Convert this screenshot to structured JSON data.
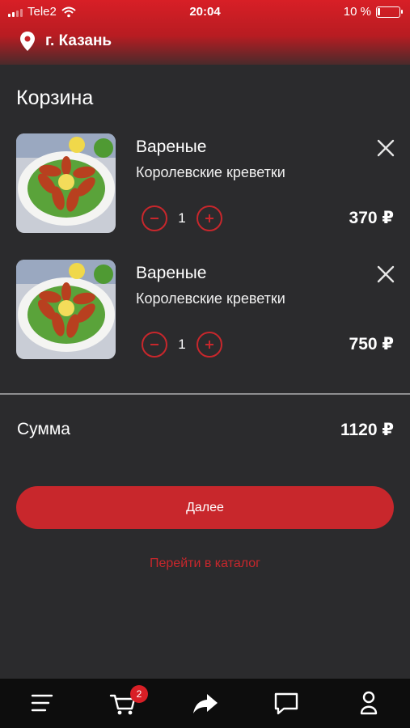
{
  "status_bar": {
    "carrier": "Tele2",
    "time": "20:04",
    "battery": "10 %",
    "battery_level": 0.1
  },
  "header": {
    "city": "г. Казань",
    "location_icon": "location-pin-icon"
  },
  "page": {
    "title": "Корзина"
  },
  "cart": {
    "items": [
      {
        "title": "Вареные",
        "subtitle": "Королевские креветки",
        "qty": "1",
        "price": "370 ₽"
      },
      {
        "title": "Вареные",
        "subtitle": "Королевские креветки",
        "qty": "1",
        "price": "750 ₽"
      }
    ]
  },
  "summary": {
    "label": "Сумма",
    "value": "1120 ₽"
  },
  "actions": {
    "next_label": "Далее",
    "catalog_link": "Перейти в каталог"
  },
  "tab_bar": {
    "cart_badge": "2",
    "icons": [
      "menu-icon",
      "cart-icon",
      "share-icon",
      "chat-icon",
      "profile-icon"
    ]
  },
  "colors": {
    "accent": "#c8272c",
    "background": "#2b2b2d",
    "tab_bar": "#0d0d0d"
  }
}
